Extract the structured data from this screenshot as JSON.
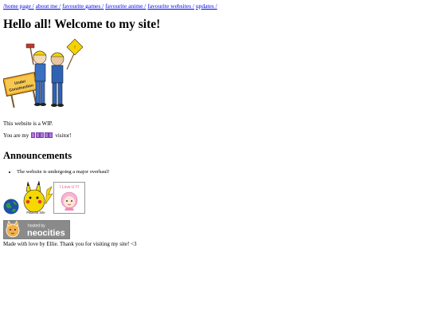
{
  "nav": {
    "items": [
      {
        "label": "/home page /"
      },
      {
        "label": "about me /"
      },
      {
        "label": "favourite games /"
      },
      {
        "label": "favourite anime /"
      },
      {
        "label": "favourite websites /"
      },
      {
        "label": "updates /"
      }
    ]
  },
  "main": {
    "title": "Hello all! Welcome to my site!",
    "under_construction_sign": "Under Construction",
    "wip_text": "This website is a WIP.",
    "visitor_prefix": "You are my",
    "visitor_suffix": "visitor!"
  },
  "announcements": {
    "heading": "Announcements",
    "items": [
      "The website is undergoing a major overhaul!"
    ]
  },
  "badges": {
    "pikachu_caption": "Pikachu Site",
    "love_text": "I Love U !!!"
  },
  "hosted": {
    "hosted_by": "hosted by",
    "brand": "neocities"
  },
  "footer": {
    "text": "Made with love by Ellie. Thank you for visiting my site! <3"
  },
  "colors": {
    "link": "#0000ee",
    "counter": "#b07bd8",
    "neocities_badge": "#8a8a8a"
  }
}
